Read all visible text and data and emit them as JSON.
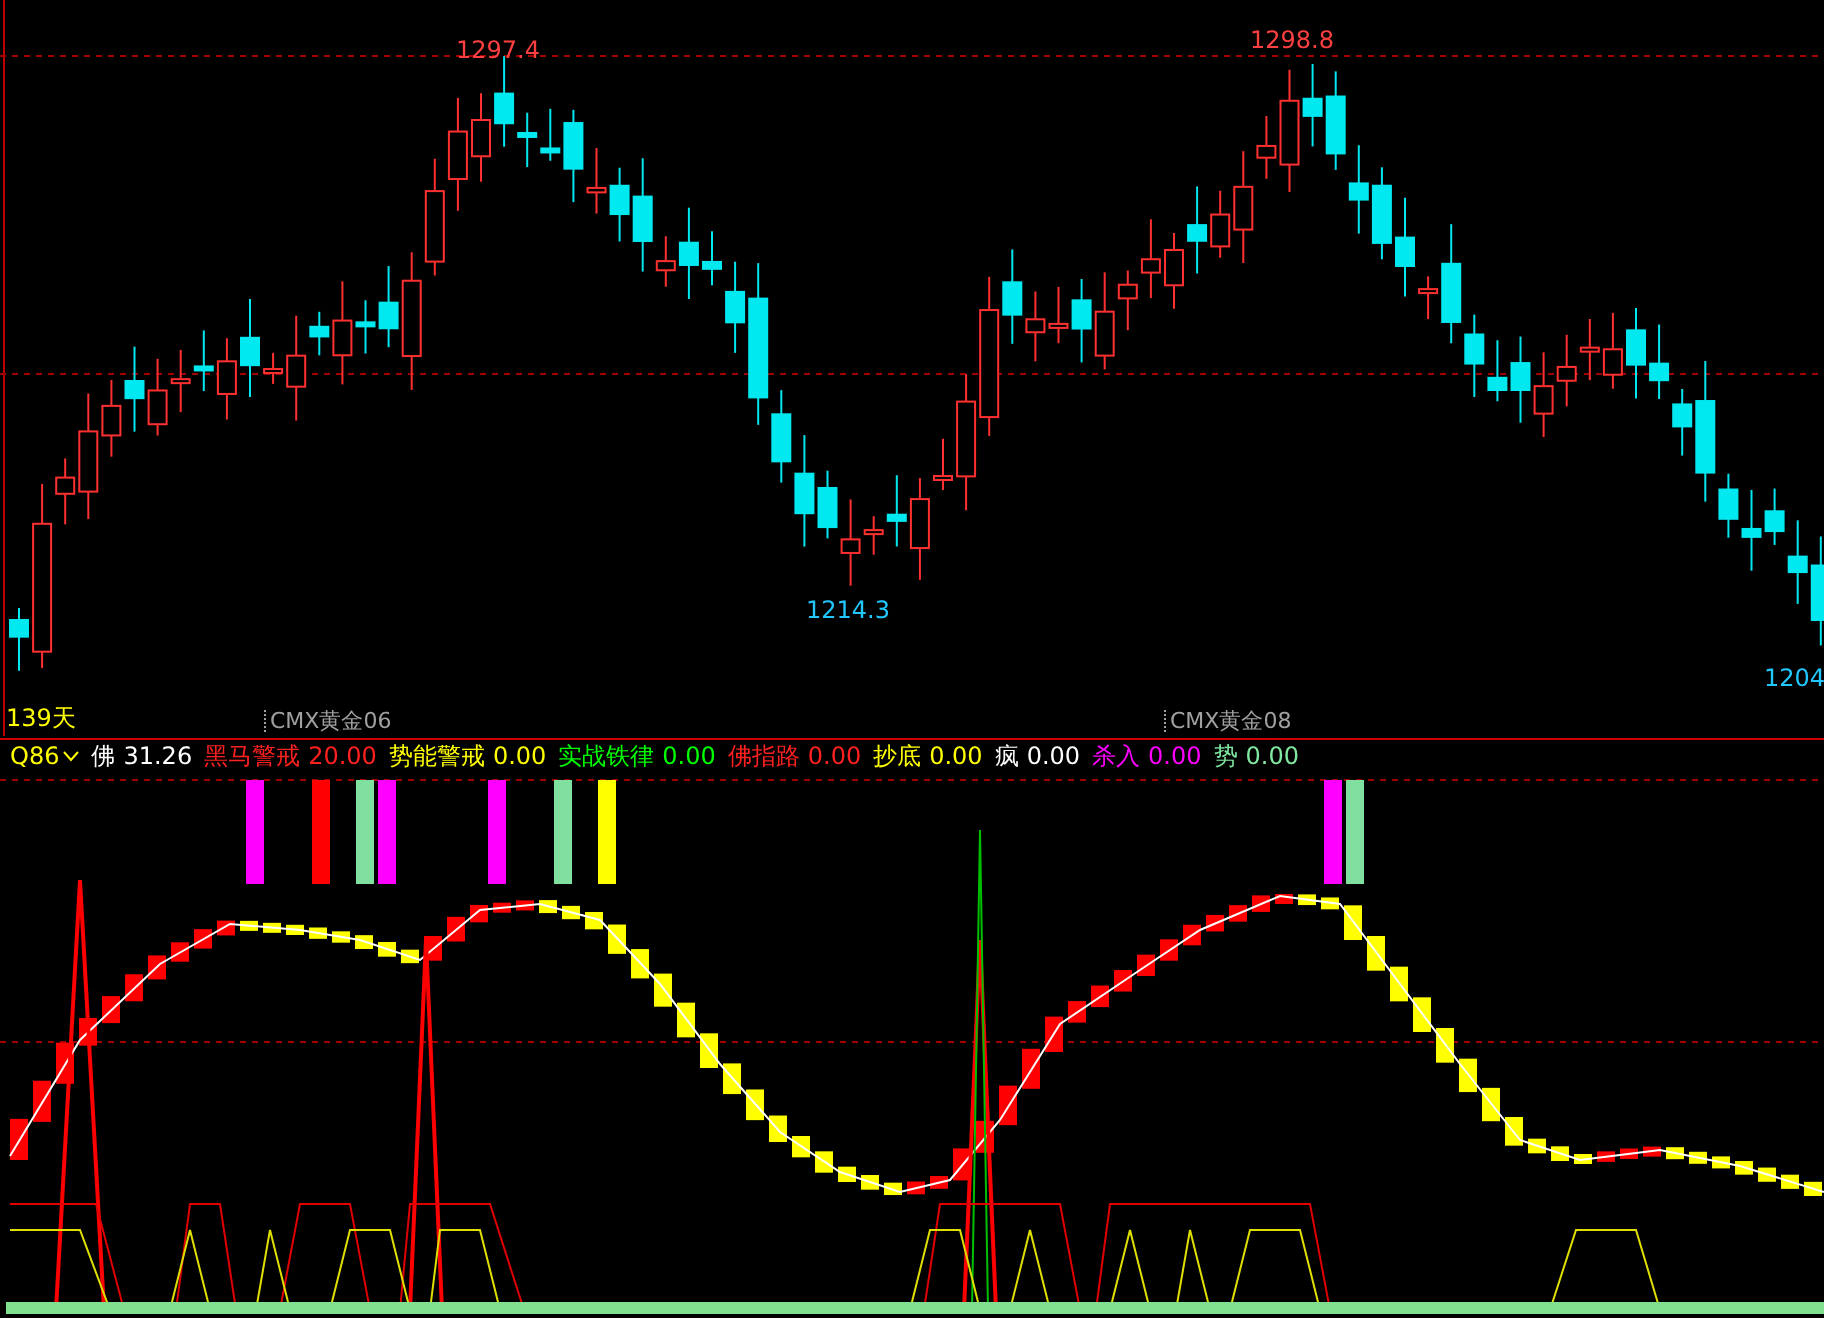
{
  "main_chart": {
    "price_labels": [
      {
        "text": "1297.4",
        "kind": "high"
      },
      {
        "text": "1298.8",
        "kind": "high"
      },
      {
        "text": "1214.3",
        "kind": "low"
      },
      {
        "text": "1204",
        "kind": "low"
      }
    ],
    "period_label": "139天",
    "contract_labels": [
      "CMX黄金06",
      "CMX黄金08"
    ]
  },
  "indicator": {
    "name": "Q86",
    "values": [
      {
        "label": "佛",
        "value": "31.26",
        "color": "#ffffff"
      },
      {
        "label": "黑马警戒",
        "value": "20.00",
        "color": "#ff2020"
      },
      {
        "label": "势能警戒",
        "value": "0.00",
        "color": "#ffff00"
      },
      {
        "label": "实战铁律",
        "value": "0.00",
        "color": "#00ff00"
      },
      {
        "label": "佛指路",
        "value": "0.00",
        "color": "#ff2020"
      },
      {
        "label": "抄底",
        "value": "0.00",
        "color": "#ffff00"
      },
      {
        "label": "疯",
        "value": "0.00",
        "color": "#ffffff"
      },
      {
        "label": "杀入",
        "value": "0.00",
        "color": "#ff00ff"
      },
      {
        "label": "势",
        "value": "0.00",
        "color": "#80e8a0"
      }
    ]
  }
}
